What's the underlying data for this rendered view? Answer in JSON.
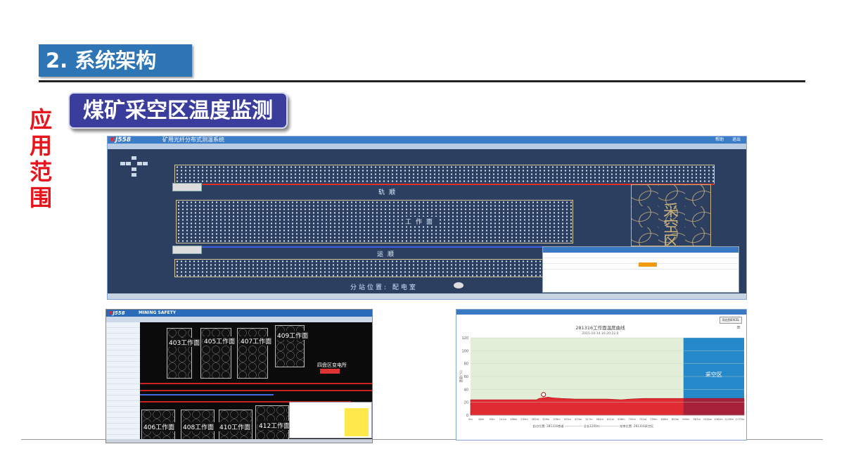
{
  "slide": {
    "section_title": "2. 系统架构",
    "subtitle": "煤矿采空区温度监测",
    "side_label": "应用范围"
  },
  "main_screen": {
    "logo_k": "K",
    "logo_rest": "J558",
    "app_title": "矿用光纤分布式测温系统",
    "menu": [
      "帮助",
      "退出"
    ],
    "roadway_top": "轨顺",
    "workface": "工作面",
    "roadway_bottom": "运顺",
    "goaf_label": "采空区",
    "station_position": "分站位置: 配电室"
  },
  "mine_screen": {
    "logo_k": "K",
    "logo_rest": "J558",
    "app_title": "MINING SAFETY",
    "zones": [
      "403工作面",
      "405工作面",
      "407工作面",
      "409工作面",
      "406工作面",
      "408工作面",
      "410工作面",
      "412工作面"
    ],
    "substation": "四盘区变电所"
  },
  "chart_window": {
    "export_button": "导出到EXCEL",
    "menu_icon": "≡"
  },
  "chart_data": {
    "type": "area",
    "title": "281316工作面温度曲线",
    "subtitle": "2015-10-14 16:20:22.0",
    "ylabel": "温度(℃)",
    "ylim": [
      0,
      120
    ],
    "yticks": [
      0,
      20,
      40,
      60,
      80,
      100,
      120
    ],
    "xlim": [
      0,
      1200
    ],
    "xticks": [
      "0m",
      "46m",
      "93m",
      "141m",
      "188m",
      "235m",
      "282m",
      "329m",
      "376m",
      "423m",
      "470m",
      "517m",
      "564m",
      "611m",
      "658m",
      "705m",
      "752m",
      "799m",
      "846m",
      "893m",
      "940m",
      "987m",
      "1034m",
      "1081m",
      "1128m",
      "1175m"
    ],
    "series": [
      {
        "x": [
          0,
          100,
          200,
          290,
          300,
          320,
          340,
          360,
          400,
          460,
          520,
          600,
          660,
          700,
          760,
          820,
          880,
          940,
          1000,
          1080,
          1200
        ],
        "values": [
          24,
          24,
          24,
          24,
          26,
          27,
          28,
          27,
          26,
          25,
          25,
          25,
          24,
          25,
          26,
          26,
          26,
          26,
          26,
          26,
          26
        ]
      }
    ],
    "annotation": "采空区",
    "goaf_range": [
      934,
      1200
    ],
    "footer": [
      "起点位置: 281316巷道",
      "总长1200m",
      "结束位置: 281316采空区"
    ]
  }
}
